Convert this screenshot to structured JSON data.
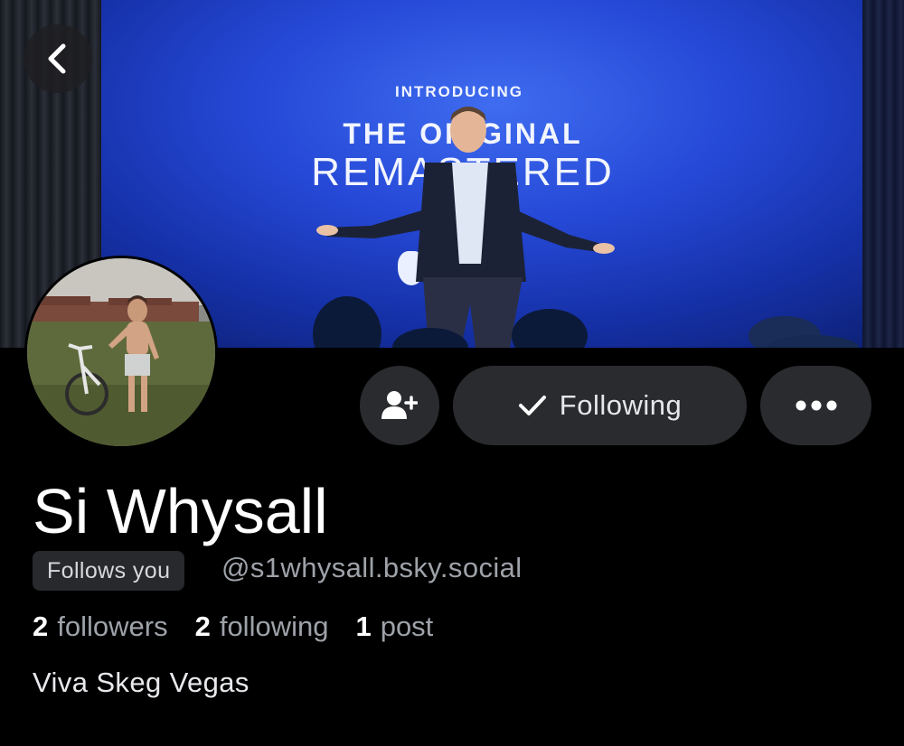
{
  "banner": {
    "intro_text": "INTRODUCING",
    "headline_line1": "THE ORIGINAL",
    "headline_line2": "REMASTERED"
  },
  "actions": {
    "follow_label": "Following"
  },
  "profile": {
    "display_name": "Si Whysall",
    "follows_you_badge": "Follows you",
    "handle": "@s1whysall.bsky.social",
    "bio": "Viva Skeg Vegas"
  },
  "stats": [
    {
      "count": "2",
      "label": "followers"
    },
    {
      "count": "2",
      "label": "following"
    },
    {
      "count": "1",
      "label": "post"
    }
  ],
  "icons": {
    "back": "chevron-left-icon",
    "add_user": "person-plus-icon",
    "following_check": "checkmark-icon",
    "more": "ellipsis-icon"
  },
  "colors": {
    "background": "#000000",
    "button_bg": "#2a2b2e",
    "secondary_text": "#9ea2a9",
    "banner_blue": "#2548d6"
  }
}
